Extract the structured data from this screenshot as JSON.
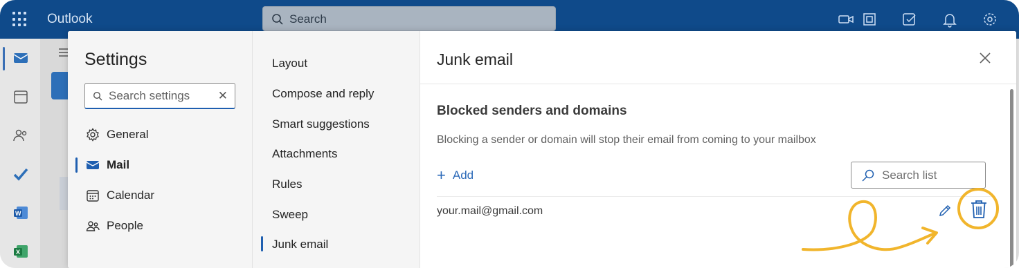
{
  "app": {
    "name": "Outlook"
  },
  "topbar": {
    "search_placeholder": "Search"
  },
  "settings": {
    "title": "Settings",
    "search_placeholder": "Search settings",
    "categories": [
      {
        "label": "General",
        "icon": "gear-icon"
      },
      {
        "label": "Mail",
        "icon": "mail-icon",
        "active": true
      },
      {
        "label": "Calendar",
        "icon": "calendar-icon"
      },
      {
        "label": "People",
        "icon": "people-icon"
      }
    ],
    "mail_sections": [
      "Layout",
      "Compose and reply",
      "Smart suggestions",
      "Attachments",
      "Rules",
      "Sweep",
      "Junk email"
    ],
    "active_section": "Junk email"
  },
  "junk_panel": {
    "title": "Junk email",
    "section_title": "Blocked senders and domains",
    "section_desc": "Blocking a sender or domain will stop their email from coming to your mailbox",
    "add_label": "Add",
    "search_list_placeholder": "Search list",
    "blocked": [
      "your.mail@gmail.com"
    ]
  },
  "colors": {
    "brand_bar": "#0f4a8a",
    "accent": "#1f5fb0",
    "highlight": "#f1b52c"
  }
}
